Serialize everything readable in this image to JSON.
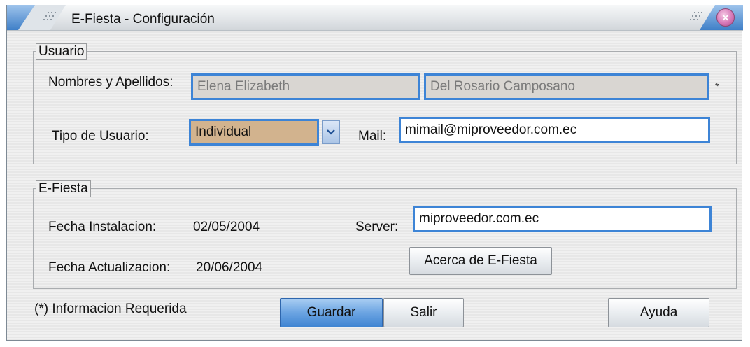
{
  "window": {
    "title": "E-Fiesta  - Configuración",
    "close_icon": "close-icon",
    "accent_color": "#3d84d6"
  },
  "usuario": {
    "legend": "Usuario",
    "nombres_label": "Nombres y Apellidos:",
    "nombres_value": "Elena Elizabeth",
    "apellidos_value": "Del Rosario Camposano",
    "required_mark": "*",
    "tipo_label": "Tipo de Usuario:",
    "tipo_value": "Individual",
    "mail_label": "Mail:",
    "mail_value": "mimail@miproveedor.com.ec"
  },
  "efiesta": {
    "legend": "E-Fiesta",
    "instalacion_label": "Fecha  Instalacion:",
    "instalacion_value": "02/05/2004",
    "actualizacion_label": "Fecha  Actualizacion:",
    "actualizacion_value": "20/06/2004",
    "server_label": "Server:",
    "server_value": "miproveedor.com.ec",
    "about_button": "Acerca de E-Fiesta"
  },
  "footer": {
    "required_note": "(*) Informacion Requerida",
    "guardar": "Guardar",
    "salir": "Salir",
    "ayuda": "Ayuda"
  }
}
